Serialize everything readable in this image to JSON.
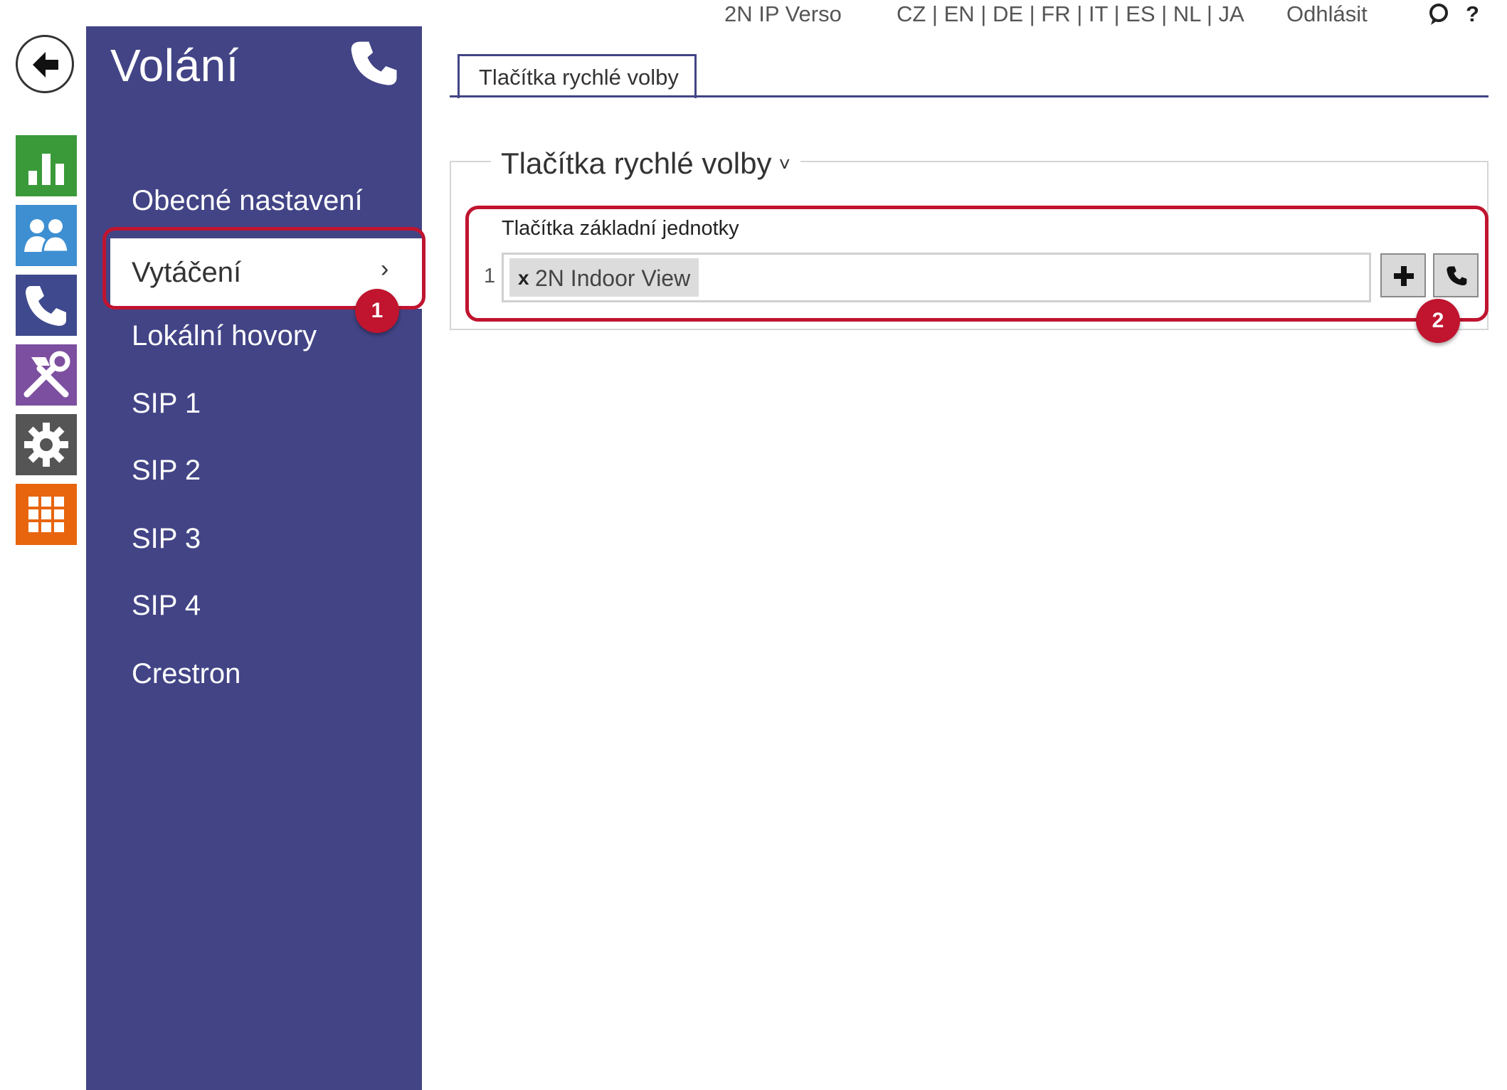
{
  "topbar": {
    "device": "2N IP Verso",
    "languages": "CZ | EN | DE | FR | IT | ES | NL | JA",
    "logout": "Odhlásit",
    "help": "?"
  },
  "rail": [
    {
      "icon": "status-chart-icon",
      "color": "#3a9a3a"
    },
    {
      "icon": "directory-users-icon",
      "color": "#3d8fd1"
    },
    {
      "icon": "calls-phone-icon",
      "color": "#3f4a8e"
    },
    {
      "icon": "hardware-tools-icon",
      "color": "#7d4fa0"
    },
    {
      "icon": "system-gear-icon",
      "color": "#555555"
    },
    {
      "icon": "services-grid-icon",
      "color": "#e8650e"
    }
  ],
  "sidebar": {
    "title": "Volání",
    "items": [
      {
        "label": "Obecné nastavení"
      },
      {
        "label": "Vytáčení",
        "active": true
      },
      {
        "label": "Lokální hovory"
      },
      {
        "label": "SIP 1"
      },
      {
        "label": "SIP 2"
      },
      {
        "label": "SIP 3"
      },
      {
        "label": "SIP 4"
      },
      {
        "label": "Crestron"
      }
    ]
  },
  "tabs": [
    {
      "label": "Tlačítka rychlé volby"
    }
  ],
  "section": {
    "title": "Tlačítka rychlé volby",
    "field_label": "Tlačítka základní jednotky",
    "rows": [
      {
        "number": "1",
        "chip_remove": "x",
        "chip_label": "2N Indoor View"
      }
    ]
  },
  "badges": {
    "one": "1",
    "two": "2"
  },
  "colors": {
    "sidebar": "#424486",
    "highlight": "#c0142f"
  }
}
